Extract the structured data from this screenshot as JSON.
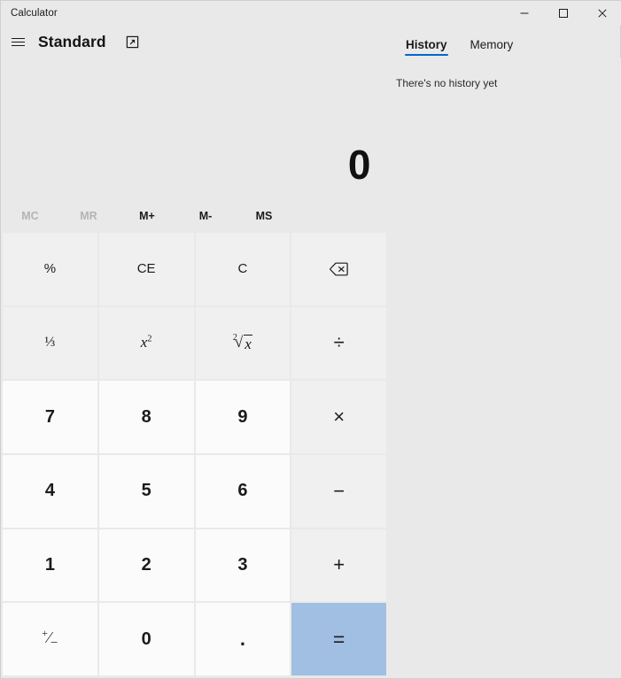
{
  "window": {
    "caption": "Calculator",
    "controls": {
      "minimize": "minimize",
      "maximize": "maximize",
      "close": "close"
    }
  },
  "header": {
    "menu_label": "Open Navigation",
    "mode_title": "Standard",
    "keep_on_top_label": "Keep on top"
  },
  "panel": {
    "tabs": [
      {
        "label": "History",
        "selected": true
      },
      {
        "label": "Memory",
        "selected": false
      }
    ],
    "empty_message": "There's no history yet"
  },
  "display": {
    "expression": "",
    "result": "0"
  },
  "memory": {
    "buttons": [
      {
        "label": "MC",
        "enabled": false
      },
      {
        "label": "MR",
        "enabled": false
      },
      {
        "label": "M+",
        "enabled": true
      },
      {
        "label": "M-",
        "enabled": true
      },
      {
        "label": "MS",
        "enabled": true
      }
    ]
  },
  "keypad": {
    "rows": [
      [
        {
          "label": "%",
          "name": "percent",
          "kind": "fn"
        },
        {
          "label": "CE",
          "name": "clear-entry",
          "kind": "fn"
        },
        {
          "label": "C",
          "name": "clear",
          "kind": "fn"
        },
        {
          "label": "",
          "name": "backspace",
          "kind": "fn",
          "icon": "backspace-icon"
        }
      ],
      [
        {
          "label": "1/x",
          "name": "reciprocal",
          "kind": "fn",
          "glyph": "reciprocal"
        },
        {
          "label": "x2",
          "name": "square",
          "kind": "fn",
          "glyph": "square"
        },
        {
          "label": "2√x",
          "name": "square-root",
          "kind": "fn",
          "glyph": "sqrt"
        },
        {
          "label": "÷",
          "name": "divide",
          "kind": "op"
        }
      ],
      [
        {
          "label": "7",
          "name": "seven",
          "kind": "num"
        },
        {
          "label": "8",
          "name": "eight",
          "kind": "num"
        },
        {
          "label": "9",
          "name": "nine",
          "kind": "num"
        },
        {
          "label": "×",
          "name": "multiply",
          "kind": "op"
        }
      ],
      [
        {
          "label": "4",
          "name": "four",
          "kind": "num"
        },
        {
          "label": "5",
          "name": "five",
          "kind": "num"
        },
        {
          "label": "6",
          "name": "six",
          "kind": "num"
        },
        {
          "label": "−",
          "name": "subtract",
          "kind": "op"
        }
      ],
      [
        {
          "label": "1",
          "name": "one",
          "kind": "num"
        },
        {
          "label": "2",
          "name": "two",
          "kind": "num"
        },
        {
          "label": "3",
          "name": "three",
          "kind": "num"
        },
        {
          "label": "+",
          "name": "add",
          "kind": "op"
        }
      ],
      [
        {
          "label": "+/-",
          "name": "negate",
          "kind": "num",
          "glyph": "plusminus"
        },
        {
          "label": "0",
          "name": "zero",
          "kind": "num"
        },
        {
          "label": ".",
          "name": "decimal-point",
          "kind": "num",
          "glyph": "dot"
        },
        {
          "label": "=",
          "name": "equals",
          "kind": "equals"
        }
      ]
    ]
  },
  "colors": {
    "accent": "#0066cc",
    "equals_bg": "#a0bfe2",
    "window_bg": "#e9e9e9",
    "number_key_bg": "#fbfbfb",
    "function_key_bg": "#f0f0f0",
    "disabled_text": "#b4b4b4"
  }
}
